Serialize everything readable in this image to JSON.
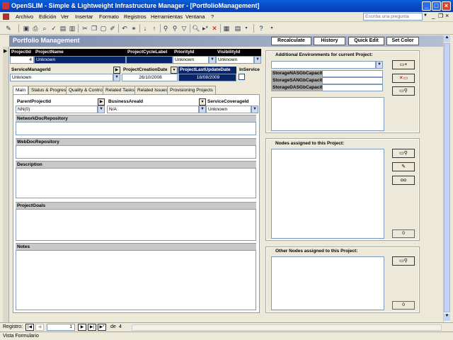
{
  "window": {
    "title": "OpenSLIM - Simple & Lightweight Infrastructure Manager - [PortfolioManagement]",
    "ask_placeholder": "Escriba una pregunta"
  },
  "menu": [
    "Archivo",
    "Edición",
    "Ver",
    "Insertar",
    "Formato",
    "Registros",
    "Herramientas",
    "Ventana",
    "?"
  ],
  "toolbar_icons": [
    "design-view-icon",
    "save-icon",
    "print-icon",
    "print-preview-icon",
    "spelling-icon",
    "cut-icon",
    "copy-icon",
    "paste-icon",
    "format-painter-icon",
    "undo-icon",
    "hyperlink-icon",
    "sort-ascending-icon",
    "sort-descending-icon",
    "filter-by-selection-icon",
    "filter-by-form-icon",
    "apply-filter-icon",
    "find-icon",
    "new-record-icon",
    "delete-record-icon",
    "database-window-icon",
    "new-object-icon",
    "help-icon"
  ],
  "form": {
    "header": "Portfolio Management",
    "buttons": {
      "recalculate": "Recalculate",
      "history": "History",
      "quick_edit": "Quick Edit",
      "set_color": "Set Color"
    },
    "fields": {
      "project_id": {
        "label": "ProjectId",
        "value": "4"
      },
      "project_name": {
        "label": "ProjectName",
        "value": "Unknown"
      },
      "cycle_label": {
        "label": "ProjectCycleLabel",
        "value": ""
      },
      "priority": {
        "label": "PriorityId",
        "value": "Unknown"
      },
      "visibility": {
        "label": "VisibilityId",
        "value": "Unknown"
      },
      "service_manager": {
        "label": "ServiceManagerId",
        "value": "Unknown"
      },
      "creation_date": {
        "label": "ProjectCreationDate",
        "value": "26/10/2008"
      },
      "last_update": {
        "label": "ProjectLastUpdateDate",
        "value": "18/08/2009"
      },
      "in_service": {
        "label": "InService"
      }
    },
    "tabs": [
      "Main",
      "Status & Progress",
      "Quality & Control",
      "Related Tasks",
      "Related Issues",
      "Provisioning Projects"
    ],
    "main": {
      "parent_project": {
        "label": "ParentProjectId",
        "value": "NN(0)"
      },
      "business_area": {
        "label": "BusinessAreaId",
        "value": "N/A"
      },
      "service_coverage": {
        "label": "ServiceCoverageId",
        "value": "Unknown"
      },
      "sections": [
        "NetworkDocRepository",
        "WebDocRepository",
        "Description",
        "ProjectGoals",
        "Notes"
      ]
    },
    "right": {
      "env_title": "Additional Environments for current Project:",
      "storage_labels": [
        "StorageNASGbCapacity",
        "StorageSANGbCapacity",
        "StorageDASGbCapacity"
      ],
      "nodes_title": "Nodes assigned to this Project:",
      "nodes_count": "0",
      "other_title": "Other Nodes assigned to this Project:",
      "other_count": "0"
    }
  },
  "nav": {
    "label": "Registro:",
    "current": "1",
    "of_label": "de",
    "total": "4"
  },
  "status": "Vista Formulario"
}
